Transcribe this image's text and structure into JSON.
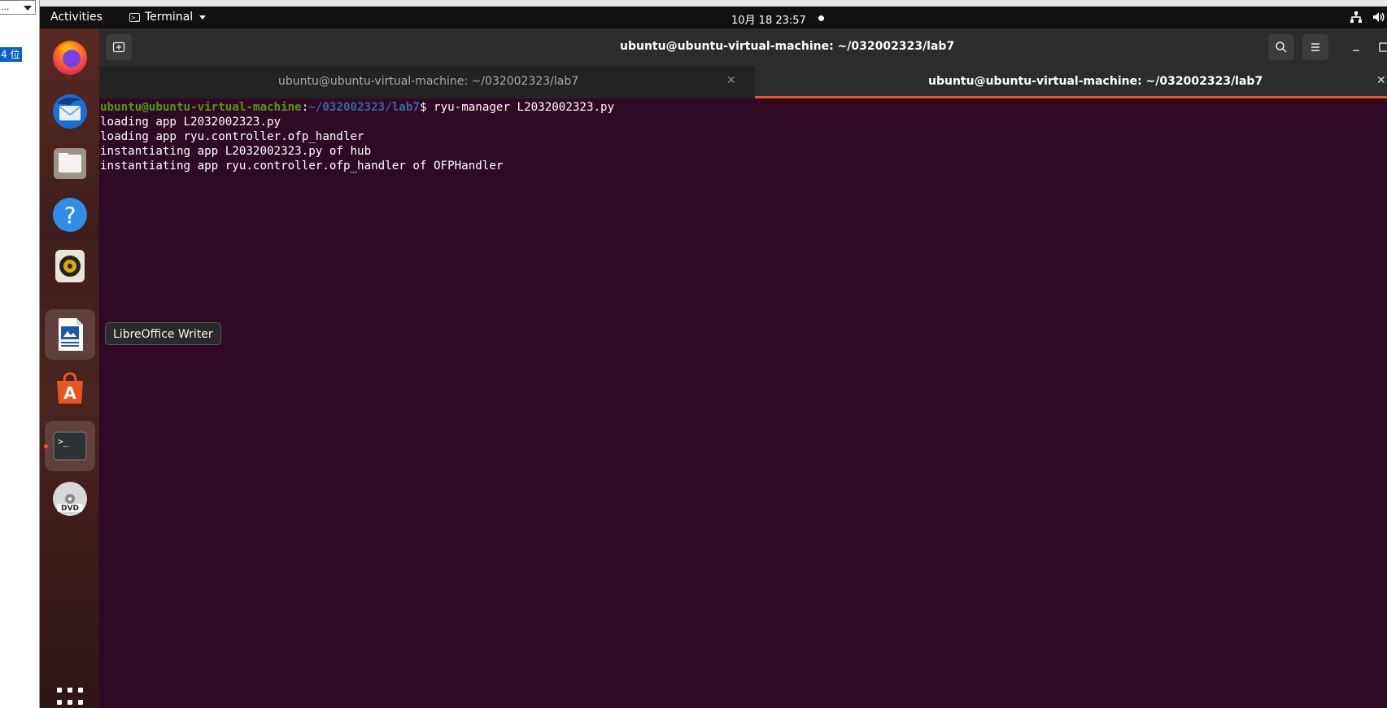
{
  "host": {
    "dropdown_text": "...",
    "selected_text": "4 位"
  },
  "gnome_bar": {
    "activities": "Activities",
    "app_name": "Terminal",
    "clock": "10月 18  23:57"
  },
  "dock": {
    "items": [
      {
        "name": "Firefox",
        "icon": "firefox-icon"
      },
      {
        "name": "Thunderbird",
        "icon": "thunderbird-icon"
      },
      {
        "name": "Files",
        "icon": "files-icon"
      },
      {
        "name": "Help",
        "icon": "help-icon"
      },
      {
        "name": "Rhythmbox",
        "icon": "rhythmbox-icon"
      },
      {
        "name": "LibreOffice Writer",
        "icon": "writer-icon"
      },
      {
        "name": "Ubuntu Software",
        "icon": "software-icon"
      },
      {
        "name": "Terminal",
        "icon": "terminal-icon"
      },
      {
        "name": "DVD",
        "icon": "dvd-icon"
      }
    ],
    "tooltip": "LibreOffice Writer"
  },
  "terminal": {
    "window_title": "ubuntu@ubuntu-virtual-machine: ~/032002323/lab7",
    "tabs": [
      {
        "label": "ubuntu@ubuntu-virtual-machine: ~/032002323/lab7",
        "active": false
      },
      {
        "label": "ubuntu@ubuntu-virtual-machine: ~/032002323/lab7",
        "active": true
      }
    ],
    "prompt_user": "ubuntu@ubuntu-virtual-machine",
    "prompt_sep": ":",
    "prompt_path": "~/032002323/lab7",
    "prompt_symbol": "$ ",
    "command": "ryu-manager L2032002323.py",
    "output": [
      "loading app L2032002323.py",
      "loading app ryu.controller.ofp_handler",
      "instantiating app L2032002323.py of hub",
      "instantiating app ryu.controller.ofp_handler of OFPHandler"
    ]
  },
  "colors": {
    "terminal_bg": "#300a24",
    "accent": "#e95420",
    "prompt_user": "#4e9a06",
    "prompt_path": "#3465a4"
  }
}
